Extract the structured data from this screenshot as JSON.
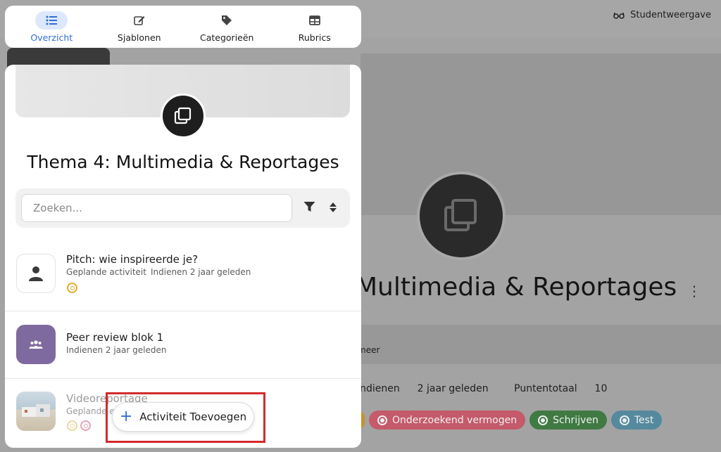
{
  "tabs": [
    {
      "label": "Overzicht",
      "icon": "list-icon",
      "active": true
    },
    {
      "label": "Sjablonen",
      "icon": "edit-icon",
      "active": false
    },
    {
      "label": "Categorieën",
      "icon": "tag-icon",
      "active": false
    },
    {
      "label": "Rubrics",
      "icon": "table-icon",
      "active": false
    }
  ],
  "header": {
    "student_view_label": "Studentweergave",
    "student_view_icon": "glasses-icon"
  },
  "panel": {
    "title": "Thema 4: Multimedia & Reportages",
    "icon": "copy-icon",
    "search": {
      "placeholder": "Zoeken...",
      "value": ""
    },
    "filter_icon": "filter-icon",
    "sort_icon": "sort-icon"
  },
  "activities": [
    {
      "title": "Pitch: wie inspireerde je?",
      "status": "Geplande activiteit",
      "due": "Indienen 2 jaar geleden",
      "icon": "person-icon",
      "goals": [
        "target-icon"
      ]
    },
    {
      "title": "Peer review blok 1",
      "status": "",
      "due": "Indienen 2 jaar geleden",
      "icon": "group-icon",
      "goals": []
    },
    {
      "title": "Videoreportage",
      "status": "Geplande e",
      "due": "",
      "icon": "photo-thumbnail",
      "goals": [
        "target-icon",
        "target-icon"
      ]
    }
  ],
  "add_button": {
    "label": "Activiteit Toevoegen",
    "icon": "plus-icon"
  },
  "background": {
    "title": "Multimedia & Reportages",
    "more_label": "meer",
    "due_label": "Indienen",
    "due_value": "2 jaar geleden",
    "points_label": "Puntentotaal",
    "points_value": "10",
    "tags": [
      {
        "label": "Onderzoekend vermogen",
        "color": "#c45a6a"
      },
      {
        "label": "Schrijven",
        "color": "#3f7a43"
      },
      {
        "label": "Test",
        "color": "#55899e"
      }
    ]
  },
  "colors": {
    "accent": "#2f6ed6",
    "active_tab_bg": "#dce8fb",
    "highlight": "#d42a2a",
    "group_thumb": "#7e6a9e"
  }
}
